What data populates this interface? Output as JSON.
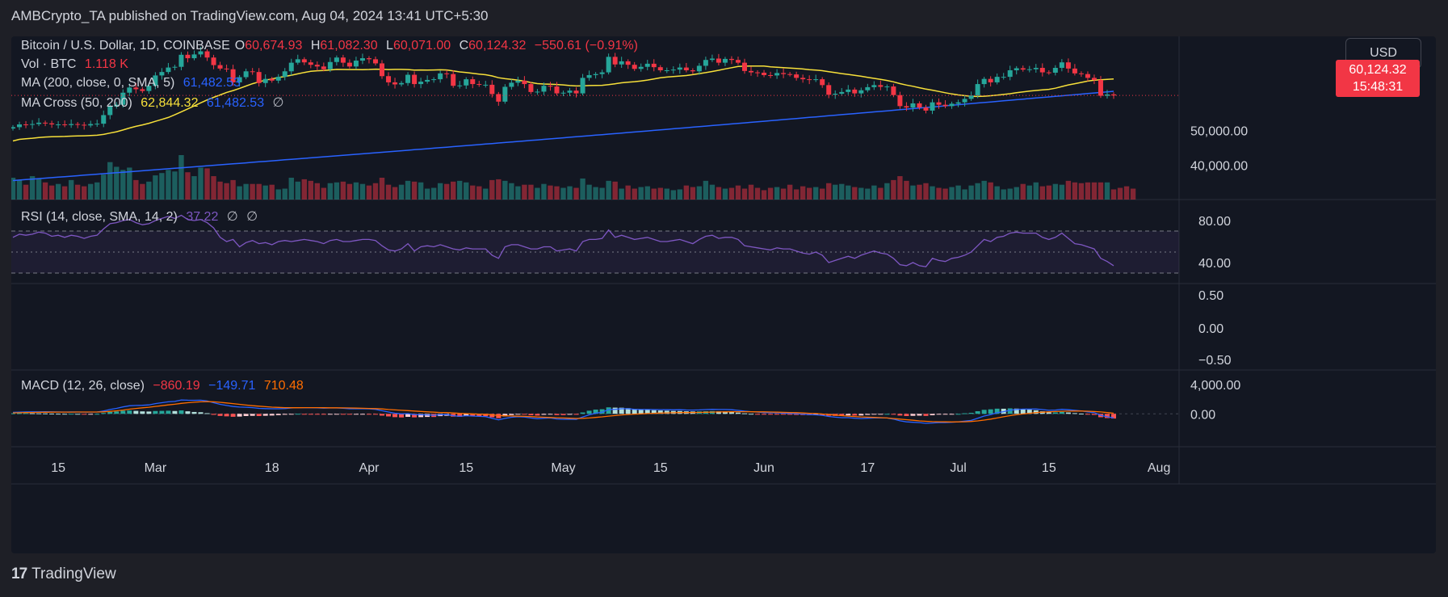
{
  "header": {
    "publisher": "AMBCrypto_TA published on TradingView.com, Aug 04, 2024 13:41 UTC+5:30"
  },
  "currency_button": "USD",
  "price_tag": {
    "price": "60,124.32",
    "countdown": "15:48:31"
  },
  "legend": {
    "symbol": "Bitcoin / U.S. Dollar, 1D, COINBASE",
    "o_label": "O",
    "o_value": "60,674.93",
    "h_label": "H",
    "h_value": "61,082.30",
    "l_label": "L",
    "l_value": "60,071.00",
    "c_label": "C",
    "c_value": "60,124.32",
    "change": "−550.61 (−0.91%)",
    "vol_label": "Vol · BTC",
    "vol_value": "1.118 K",
    "ma_label": "MA (200, close, 0, SMA, 5)",
    "ma_value": "61,482.53",
    "macross_label": "MA Cross (50, 200)",
    "macross_v1": "62,844.32",
    "macross_v2": "61,482.53",
    "macross_v3": "∅",
    "rsi_label": "RSI (14, close, SMA, 14, 2)",
    "rsi_value": "37.22",
    "rsi_v2": "∅",
    "rsi_v3": "∅",
    "macd_label": "MACD (12, 26, close)",
    "macd_v1": "−860.19",
    "macd_v2": "−149.71",
    "macd_v3": "710.48"
  },
  "footer": {
    "logo": "17",
    "brand": "TradingView"
  },
  "colors": {
    "up": "#26a69a",
    "down": "#f23645",
    "ma50": "#f7e03a",
    "ma200": "#2962ff",
    "rsi": "#7e57c2",
    "macd": "#2962ff",
    "signal": "#ff6d00"
  },
  "chart_data": {
    "type": "candlestick",
    "price_axis": {
      "ticks": [
        "50,000.00",
        "40,000.00"
      ],
      "ylim": [
        30000,
        75000
      ]
    },
    "rsi_axis": {
      "ticks": [
        "80.00",
        "40.00"
      ],
      "ylim": [
        20,
        100
      ],
      "bands": [
        70,
        50,
        30
      ]
    },
    "empty_axis": {
      "ticks": [
        "0.50",
        "0.00",
        "−0.50"
      ]
    },
    "macd_axis": {
      "ticks": [
        "4,000.00",
        "0.00"
      ],
      "ylim": [
        -4500,
        6000
      ]
    },
    "x_ticks": [
      "15",
      "Mar",
      "18",
      "Apr",
      "15",
      "May",
      "15",
      "Jun",
      "17",
      "Jul",
      "15",
      "Aug"
    ],
    "x_tick_days": [
      0,
      15,
      33,
      48,
      63,
      78,
      93,
      109,
      125,
      139,
      153,
      170
    ],
    "start_day_offset": -7,
    "closes": [
      51000,
      51800,
      51700,
      51900,
      52300,
      52100,
      51800,
      51800,
      51600,
      51900,
      51700,
      51500,
      51900,
      52000,
      54500,
      57000,
      57500,
      61000,
      62500,
      62000,
      61500,
      63000,
      66000,
      67000,
      68300,
      68500,
      72000,
      71000,
      72100,
      73000,
      71200,
      69000,
      68000,
      67800,
      64000,
      65500,
      67200,
      67000,
      63800,
      65000,
      64500,
      65600,
      67200,
      69700,
      70700,
      69800,
      69100,
      68600,
      67800,
      69900,
      71200,
      69700,
      68600,
      70300,
      71000,
      70700,
      69500,
      65800,
      64000,
      63400,
      63800,
      66200,
      63500,
      64200,
      64700,
      64900,
      66600,
      66400,
      63000,
      63100,
      64900,
      63500,
      63300,
      63300,
      60600,
      58400,
      62700,
      63900,
      64500,
      63500,
      61200,
      61300,
      63000,
      62800,
      60800,
      61000,
      61600,
      60800,
      65300,
      66100,
      66400,
      66900,
      71400,
      69200,
      70100,
      69100,
      67900,
      68500,
      69400,
      68400,
      67500,
      67500,
      67700,
      68300,
      67500,
      67200,
      68800,
      70500,
      70900,
      69700,
      70800,
      70500,
      69700,
      67300,
      66900,
      66800,
      66100,
      66000,
      66700,
      66400,
      66300,
      65300,
      64900,
      64700,
      64900,
      63200,
      60400,
      60700,
      61200,
      61900,
      60800,
      61700,
      62600,
      63200,
      62700,
      62800,
      60300,
      57100,
      56700,
      57900,
      56700,
      55800,
      58200,
      57500,
      57100,
      57800,
      58200,
      59200,
      60200,
      63500,
      65000,
      64000,
      65600,
      65600,
      67500,
      68100,
      67700,
      67800,
      68200,
      66900,
      66800,
      68200,
      69800,
      68000,
      66600,
      66400,
      65300,
      64700,
      60100,
      60500,
      60200
    ],
    "volumes": [
      28,
      25,
      19,
      30,
      27,
      22,
      18,
      20,
      17,
      25,
      19,
      17,
      20,
      22,
      32,
      48,
      42,
      38,
      41,
      25,
      20,
      23,
      31,
      34,
      38,
      36,
      57,
      35,
      30,
      41,
      40,
      30,
      23,
      21,
      25,
      17,
      20,
      20,
      20,
      18,
      19,
      13,
      14,
      28,
      23,
      26,
      24,
      21,
      15,
      21,
      22,
      23,
      20,
      22,
      20,
      18,
      21,
      28,
      19,
      16,
      19,
      24,
      23,
      22,
      14,
      15,
      21,
      20,
      23,
      24,
      22,
      18,
      17,
      14,
      25,
      26,
      24,
      21,
      17,
      19,
      19,
      15,
      20,
      18,
      17,
      15,
      17,
      15,
      27,
      19,
      16,
      15,
      24,
      23,
      14,
      18,
      14,
      16,
      17,
      14,
      15,
      14,
      12,
      13,
      18,
      16,
      17,
      24,
      19,
      16,
      14,
      15,
      18,
      14,
      19,
      15,
      12,
      15,
      16,
      14,
      19,
      13,
      17,
      15,
      16,
      14,
      21,
      19,
      20,
      18,
      16,
      15,
      14,
      18,
      15,
      21,
      25,
      30,
      24,
      18,
      19,
      21,
      17,
      15,
      14,
      16,
      18,
      13,
      18,
      21,
      24,
      22,
      17,
      13,
      14,
      16,
      20,
      18,
      22,
      17,
      18,
      20,
      19,
      24,
      22,
      21,
      22,
      22,
      22,
      22,
      13,
      15,
      17,
      14
    ],
    "rsi": [
      64,
      67,
      66,
      67,
      69,
      68,
      65,
      66,
      64,
      66,
      65,
      63,
      65,
      66,
      72,
      77,
      78,
      80,
      81,
      78,
      76,
      77,
      80,
      82,
      84,
      82,
      85,
      81,
      80,
      81,
      78,
      73,
      64,
      60,
      62,
      55,
      59,
      61,
      58,
      59,
      57,
      60,
      61,
      60,
      61,
      62,
      61,
      60,
      58,
      61,
      62,
      60,
      60,
      61,
      62,
      62,
      61,
      56,
      52,
      51,
      53,
      58,
      51,
      55,
      56,
      55,
      57,
      55,
      53,
      52,
      54,
      53,
      53,
      53,
      47,
      44,
      55,
      57,
      57,
      55,
      53,
      53,
      55,
      55,
      51,
      52,
      53,
      51,
      60,
      62,
      62,
      63,
      71,
      64,
      66,
      64,
      62,
      63,
      64,
      62,
      60,
      60,
      61,
      62,
      60,
      58,
      62,
      65,
      66,
      63,
      64,
      64,
      62,
      56,
      55,
      54,
      53,
      52,
      54,
      53,
      53,
      51,
      49,
      48,
      50,
      47,
      40,
      42,
      44,
      46,
      44,
      47,
      49,
      51,
      49,
      48,
      44,
      38,
      37,
      40,
      37,
      36,
      44,
      42,
      41,
      44,
      45,
      47,
      50,
      56,
      62,
      60,
      64,
      65,
      68,
      69,
      68,
      68,
      68,
      64,
      62,
      64,
      68,
      63,
      58,
      57,
      55,
      53,
      44,
      41,
      37
    ],
    "macd": [
      210,
      240,
      260,
      270,
      280,
      285,
      270,
      260,
      250,
      260,
      255,
      240,
      245,
      255,
      400,
      600,
      750,
      950,
      1100,
      1150,
      1170,
      1230,
      1400,
      1520,
      1650,
      1700,
      1900,
      1870,
      1850,
      1870,
      1760,
      1520,
      1300,
      1150,
      1000,
      930,
      900,
      850,
      750,
      720,
      690,
      700,
      730,
      800,
      850,
      840,
      840,
      820,
      780,
      800,
      810,
      760,
      700,
      690,
      700,
      680,
      620,
      430,
      250,
      90,
      0,
      30,
      -100,
      -120,
      -140,
      -200,
      -120,
      -100,
      -260,
      -340,
      -260,
      -300,
      -340,
      -380,
      -600,
      -820,
      -620,
      -470,
      -400,
      -430,
      -570,
      -660,
      -600,
      -560,
      -700,
      -740,
      -720,
      -750,
      -420,
      -130,
      90,
      220,
      580,
      620,
      690,
      690,
      620,
      600,
      600,
      580,
      570,
      560,
      550,
      560,
      530,
      520,
      540,
      580,
      620,
      600,
      600,
      560,
      470,
      370,
      300,
      240,
      180,
      160,
      140,
      100,
      70,
      20,
      -40,
      -100,
      -130,
      -200,
      -350,
      -450,
      -520,
      -520,
      -600,
      -640,
      -600,
      -570,
      -560,
      -560,
      -720,
      -950,
      -1100,
      -1150,
      -1200,
      -1300,
      -1250,
      -1200,
      -1200,
      -1150,
      -1100,
      -1000,
      -900,
      -600,
      -300,
      -100,
      150,
      300,
      500,
      600,
      650,
      650,
      660,
      580,
      480,
      520,
      620,
      560,
      480,
      410,
      280,
      180,
      -200,
      -400,
      -550
    ],
    "signal": [
      130,
      150,
      170,
      190,
      210,
      225,
      235,
      240,
      240,
      245,
      250,
      250,
      250,
      250,
      280,
      340,
      420,
      520,
      640,
      740,
      830,
      910,
      1010,
      1110,
      1220,
      1310,
      1430,
      1520,
      1590,
      1650,
      1670,
      1650,
      1580,
      1490,
      1400,
      1300,
      1200,
      1120,
      1050,
      980,
      920,
      880,
      850,
      840,
      840,
      850,
      850,
      850,
      840,
      830,
      830,
      820,
      800,
      780,
      760,
      740,
      720,
      670,
      600,
      540,
      490,
      440,
      380,
      330,
      280,
      230,
      190,
      170,
      120,
      70,
      30,
      0,
      -30,
      -60,
      -130,
      -230,
      -270,
      -300,
      -320,
      -340,
      -380,
      -430,
      -470,
      -500,
      -530,
      -570,
      -600,
      -630,
      -610,
      -560,
      -490,
      -410,
      -310,
      -230,
      -150,
      -90,
      -40,
      0,
      40,
      80,
      110,
      130,
      150,
      170,
      180,
      190,
      200,
      220,
      240,
      260,
      270,
      290,
      300,
      300,
      290,
      280,
      270,
      250,
      230,
      210,
      190,
      160,
      120,
      80,
      40,
      -20,
      -90,
      -170,
      -240,
      -310,
      -370,
      -420,
      -460,
      -490,
      -520,
      -560,
      -640,
      -720,
      -800,
      -880,
      -960,
      -1020,
      -1060,
      -1090,
      -1100,
      -1110,
      -1100,
      -1080,
      -1040,
      -960,
      -850,
      -720,
      -560,
      -400,
      -250,
      -120,
      -10,
      80,
      170,
      230,
      280,
      320,
      350,
      370,
      380,
      380,
      360,
      320,
      260,
      180,
      90
    ]
  }
}
